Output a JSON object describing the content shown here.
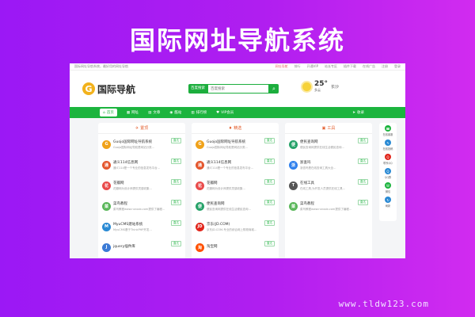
{
  "banner": {
    "title": "国际网址导航系统",
    "watermark": "www.tldw123.com"
  },
  "topbar": {
    "announcement": "国际网址导航系统，最好用的网址导航",
    "links": [
      "网址导航",
      "排行",
      "开通VIP",
      "站长专区",
      "插件下载",
      "在线广告",
      "注册",
      "登录"
    ]
  },
  "header": {
    "logo_text": "国际导航",
    "logo_glyph": "G",
    "search": {
      "engine": "百度搜索",
      "placeholder": "百度搜索"
    },
    "weather": {
      "temp": "25",
      "unit": "°",
      "cond": "多云",
      "city": "长沙"
    }
  },
  "nav": {
    "items": [
      "首页",
      "网址",
      "文章",
      "酷站",
      "排行榜",
      "VIP会员"
    ],
    "right": "收录"
  },
  "columns": [
    {
      "title": "置顶",
      "sites": [
        {
          "name": "Guojo国际网址导航系统",
          "desc": "Guojo国际网址导航是网站分类…",
          "color": "#f0a21a",
          "glyph": "G"
        },
        {
          "name": "通义114信息网",
          "desc": "通义114是一个专业的信息发布平台…",
          "color": "#e4572e",
          "glyph": "通"
        },
        {
          "name": "花瓣网",
          "desc": "花瓣网为设计师提供灵感收集…",
          "color": "#e94b4b",
          "glyph": "花"
        },
        {
          "name": "菜鸟教程",
          "desc": "菜鸟教程www.runoob.com提供了编程…",
          "color": "#5cb85c",
          "glyph": "菜"
        },
        {
          "name": "MyuCMS建站系统",
          "desc": "MyuCMS基于ThinkPHP开发…",
          "color": "#2a8ad4",
          "glyph": "M"
        },
        {
          "name": "jquery插件库",
          "desc": "",
          "color": "#3b7bd6",
          "glyph": "J"
        }
      ]
    },
    {
      "title": "精选",
      "sites": [
        {
          "name": "Guojo国际网址导航系统",
          "desc": "Guojo国际网址导航是网站分类…",
          "color": "#f0a21a",
          "glyph": "G"
        },
        {
          "name": "通义114信息网",
          "desc": "通义114是一个专业的信息发布平台…",
          "color": "#e4572e",
          "glyph": "通"
        },
        {
          "name": "花瓣网",
          "desc": "花瓣网为设计师提供灵感收集…",
          "color": "#e94b4b",
          "glyph": "花"
        },
        {
          "name": "便民查询网",
          "desc": "便民查询网提供在线生活便民查询…",
          "color": "#26a269",
          "glyph": "便"
        },
        {
          "name": "京东(JD.COM)",
          "desc": "京东JD.COM-专业的综合网上购物商城…",
          "color": "#e1251b",
          "glyph": "JD"
        },
        {
          "name": "淘宝网",
          "desc": "",
          "color": "#ff5000",
          "glyph": "淘"
        }
      ]
    },
    {
      "title": "工具",
      "sites": [
        {
          "name": "便民查询网",
          "desc": "便民查询网提供在线生活便民查询…",
          "color": "#26a269",
          "glyph": "便"
        },
        {
          "name": "浙查吗",
          "desc": "浙查吗是在线查询工具大全…",
          "color": "#2f80ed",
          "glyph": "浙"
        },
        {
          "name": "在线工具",
          "desc": "在线工具,为开发人员提供在线工具…",
          "color": "#555555",
          "glyph": "T"
        },
        {
          "name": "菜鸟教程",
          "desc": "菜鸟教程www.runoob.com提供了编程…",
          "color": "#5cb85c",
          "glyph": "菜"
        }
      ]
    }
  ],
  "visit_label": "直达",
  "sidebar": [
    {
      "label": "在线客服",
      "color": "#1cb43e",
      "glyph": "☎"
    },
    {
      "label": "在线投稿",
      "color": "#2a8ad4",
      "glyph": "✎"
    },
    {
      "label": "联系QQ",
      "color": "#e1251b",
      "glyph": "Q"
    },
    {
      "label": "QQ群",
      "color": "#2a8ad4",
      "glyph": "Q"
    },
    {
      "label": "微信",
      "color": "#1cb43e",
      "glyph": "W"
    },
    {
      "label": "刷新",
      "color": "#2a8ad4",
      "glyph": "↻"
    }
  ],
  "colors": {
    "brand_green": "#1cb43e",
    "banner_purple": "#b01ef0"
  }
}
